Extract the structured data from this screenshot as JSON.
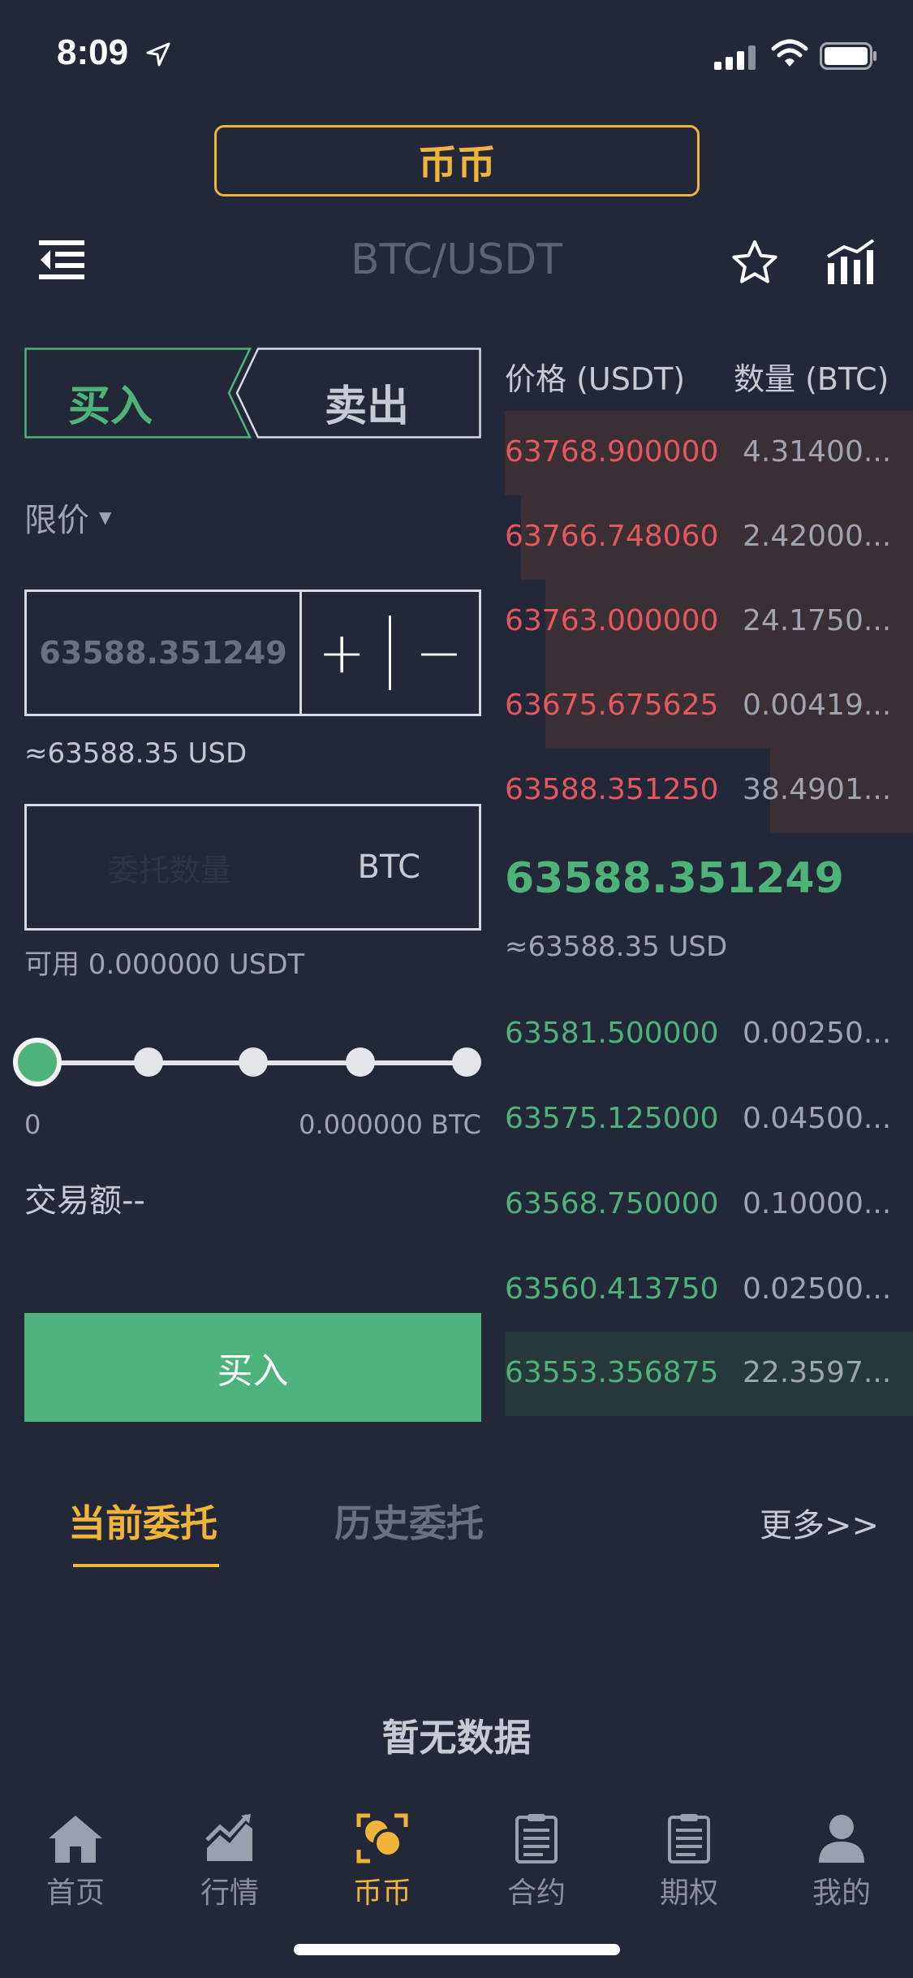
{
  "status_bar": {
    "time": "8:09"
  },
  "header": {
    "mode_label": "币币",
    "pair": "BTC/USDT"
  },
  "trade_form": {
    "tab_buy": "买入",
    "tab_sell": "卖出",
    "order_type": "限价",
    "price_value": "63588.351249",
    "price_increase": "+",
    "price_decrease": "−",
    "price_usd": "≈63588.35 USD",
    "qty_placeholder": "委托数量",
    "qty_unit": "BTC",
    "available": "可用 0.000000 USDT",
    "slider_value": 0,
    "slider_min": "0",
    "slider_max": "0.000000 BTC",
    "trade_amount": "交易额--",
    "submit_label": "买入"
  },
  "order_book": {
    "header_price": "价格 (USDT)",
    "header_qty": "数量 (BTC)",
    "asks": [
      {
        "price": "63768.900000",
        "qty": "4.31400...",
        "depth": 1.0
      },
      {
        "price": "63766.748060",
        "qty": "2.42000...",
        "depth": 0.96
      },
      {
        "price": "63763.000000",
        "qty": "24.1750...",
        "depth": 0.9
      },
      {
        "price": "63675.675625",
        "qty": "0.00419...",
        "depth": 0.9
      },
      {
        "price": "63588.351250",
        "qty": "38.4901...",
        "depth": 0.35
      }
    ],
    "last_price": "63588.351249",
    "last_price_usd": "≈63588.35 USD",
    "bids": [
      {
        "price": "63581.500000",
        "qty": "0.00250...",
        "depth": 0
      },
      {
        "price": "63575.125000",
        "qty": "0.04500...",
        "depth": 0
      },
      {
        "price": "63568.750000",
        "qty": "0.10000...",
        "depth": 0
      },
      {
        "price": "63560.413750",
        "qty": "0.02500...",
        "depth": 0
      },
      {
        "price": "63553.356875",
        "qty": "22.3597...",
        "depth": 1.0
      }
    ]
  },
  "orders": {
    "tab_current": "当前委托",
    "tab_history": "历史委托",
    "more": "更多>>",
    "empty": "暂无数据"
  },
  "bottom_nav": [
    {
      "label": "首页",
      "icon": "home-icon"
    },
    {
      "label": "行情",
      "icon": "market-chart-icon"
    },
    {
      "label": "币币",
      "icon": "coins-icon",
      "active": true
    },
    {
      "label": "合约",
      "icon": "contract-clipboard-icon"
    },
    {
      "label": "期权",
      "icon": "options-clipboard-icon"
    },
    {
      "label": "我的",
      "icon": "user-icon"
    }
  ],
  "colors": {
    "background": "#232838",
    "accent": "#f0b43b",
    "buy_green": "#4eb37a",
    "sell_red": "#e4575f"
  }
}
